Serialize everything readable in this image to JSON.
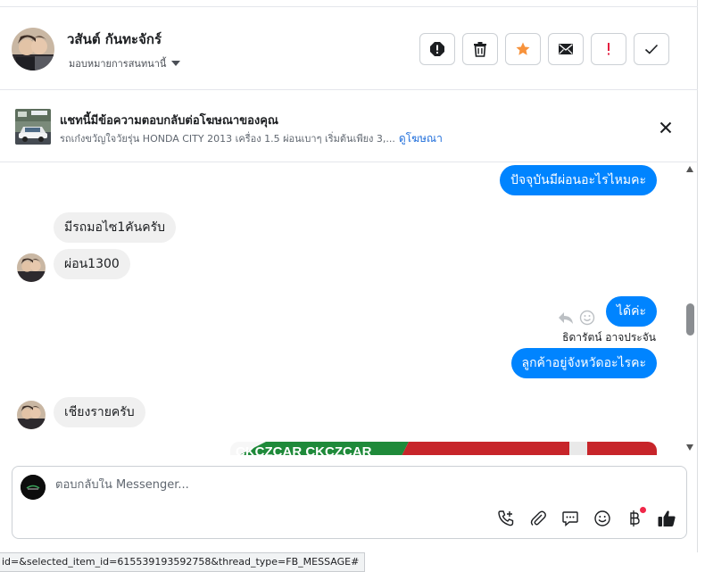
{
  "header": {
    "contact_name": "วสันต์ กันทะจักร์",
    "assign_label": "มอบหมายการสนทนานี้",
    "toolbar": [
      {
        "name": "spam-icon",
        "color": "#1c1e21"
      },
      {
        "name": "trash-icon",
        "color": "#1c1e21"
      },
      {
        "name": "star-icon",
        "color": "#f7923b"
      },
      {
        "name": "envelope-icon",
        "color": "#1c1e21"
      },
      {
        "name": "exclamation-icon",
        "color": "#e41e3f"
      },
      {
        "name": "check-icon",
        "color": "#1c1e21"
      }
    ]
  },
  "ad_banner": {
    "title": "แชทนี้มีข้อความตอบกลับต่อโฆษณาของคุณ",
    "description": "รถเก๋งขวัญใจวัยรุ่น HONDA CITY 2013 เครื่อง 1.5 ผ่อนเบาๆ เริ่มต้นเพียง 3,...",
    "link_label": "ดูโฆษณา"
  },
  "messages": {
    "m1": "ปัจจุบันมีผ่อนอะไรไหมคะ",
    "m2": "มีรถมอไซ1คันครับ",
    "m3": "ผ่อน1300",
    "m4": "ได้ค่ะ",
    "m4_sender": "ธิดารัตน์ อาจประจัน",
    "m5": "ลูกค้าอยู่จังหวัดอะไรคะ",
    "m6": "เชียงรายครับ",
    "ad_image_text": "CKCZCAR CKCZCAR"
  },
  "reply": {
    "placeholder": "ตอบกลับใน Messenger..."
  },
  "status_bar": {
    "url": "id=&selected_item_id=615539193592758&thread_type=FB_MESSAGE#"
  },
  "colors": {
    "outgoing_bubble": "#0084ff",
    "incoming_bubble": "#f0f0f0",
    "link": "#216fdb"
  }
}
